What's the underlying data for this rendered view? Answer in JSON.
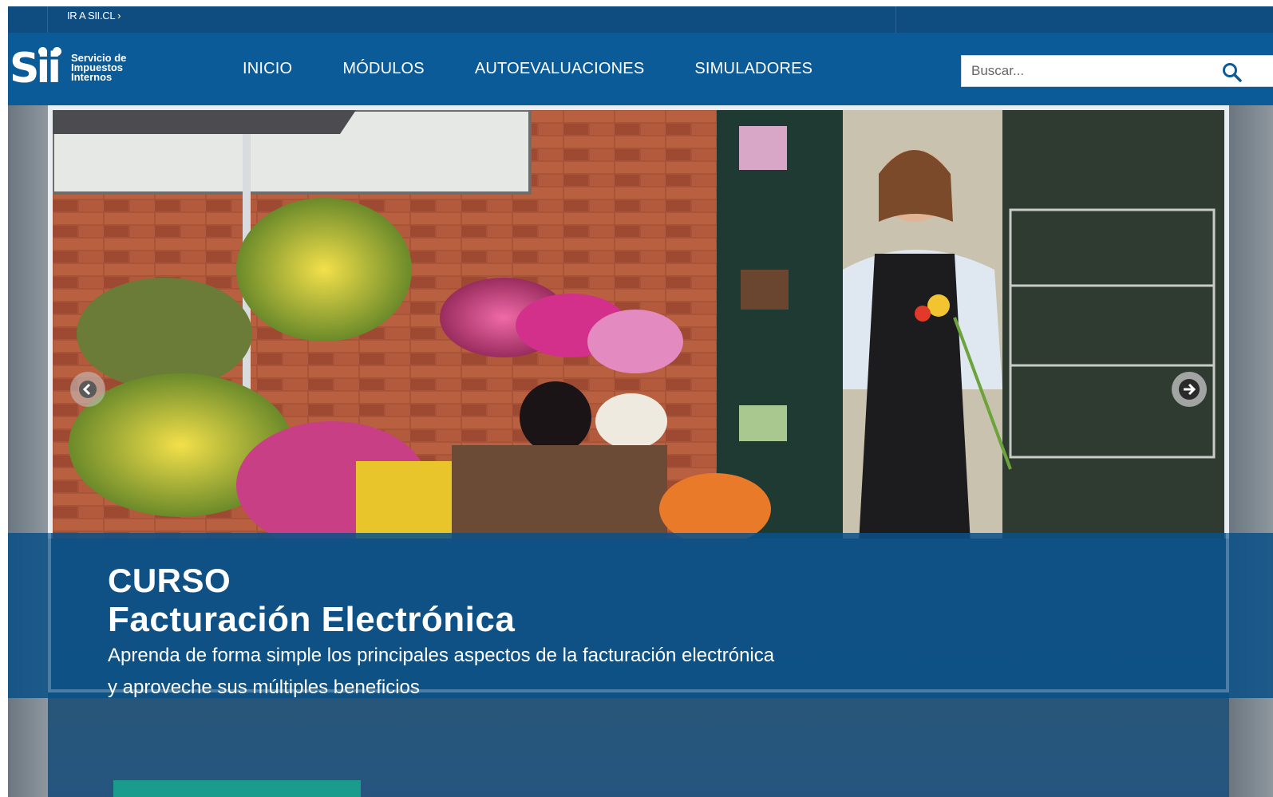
{
  "topbar": {
    "sii_link": "IR A SII.CL ›"
  },
  "header": {
    "logo_mark": "Sii",
    "logo_text": [
      "Servicio de",
      "Impuestos",
      "Internos"
    ],
    "nav": [
      "INICIO",
      "MÓDULOS",
      "AUTOEVALUACIONES",
      "SIMULADORES"
    ],
    "search_placeholder": "Buscar..."
  },
  "hero": {
    "title_line1": "CURSO",
    "title_line2": "Facturación Electrónica",
    "description_line1": "Aprenda de forma simple los principales aspectos de la facturación electrónica",
    "description_line2": "y aproveche sus múltiples beneficios"
  },
  "icons": {
    "search": "search-icon",
    "prev": "arrow-left-icon",
    "next": "arrow-right-icon"
  },
  "colors": {
    "topbar": "#0f4c80",
    "header": "#0a5b98",
    "caption": "#0a5087",
    "cta": "#1a9c8c"
  }
}
